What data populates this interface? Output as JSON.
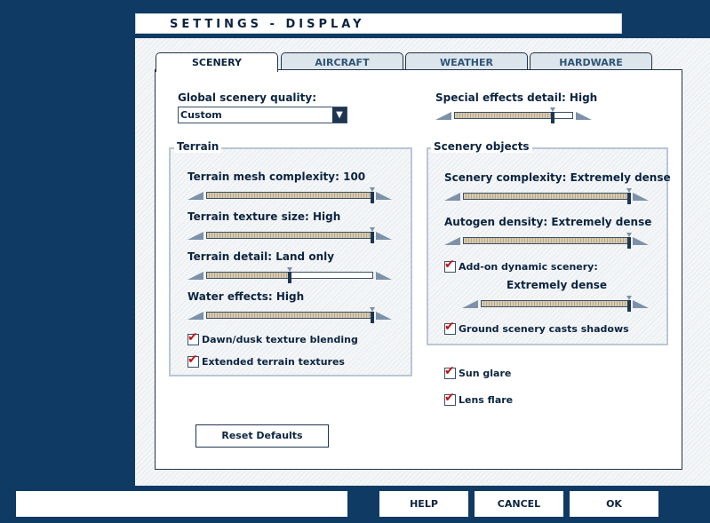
{
  "window": {
    "title": "SETTINGS - DISPLAY"
  },
  "tabs": [
    {
      "label": "SCENERY",
      "active": true
    },
    {
      "label": "AIRCRAFT",
      "active": false
    },
    {
      "label": "WEATHER",
      "active": false
    },
    {
      "label": "HARDWARE",
      "active": false
    }
  ],
  "global_quality": {
    "label": "Global scenery quality:",
    "value": "Custom"
  },
  "special_effects": {
    "label": "Special effects detail: High",
    "level": 0.83
  },
  "terrain": {
    "title": "Terrain",
    "sliders": [
      {
        "label": "Terrain mesh complexity: 100",
        "level": 1.0
      },
      {
        "label": "Terrain texture size: High",
        "level": 1.0
      },
      {
        "label": "Terrain detail: Land only",
        "level": 0.5
      },
      {
        "label": "Water effects: High",
        "level": 1.0
      }
    ],
    "checkboxes": [
      {
        "label": "Dawn/dusk texture blending",
        "checked": true
      },
      {
        "label": "Extended terrain textures",
        "checked": true
      }
    ]
  },
  "scenery_objects": {
    "title": "Scenery objects",
    "sliders": [
      {
        "label": "Scenery complexity: Extremely dense",
        "level": 1.0
      },
      {
        "label": "Autogen density: Extremely dense",
        "level": 1.0
      }
    ],
    "addon": {
      "label": "Add-on dynamic scenery:",
      "checked": true,
      "value_label": "Extremely dense",
      "level": 1.0
    },
    "shadows": {
      "label": "Ground scenery casts shadows",
      "checked": true
    }
  },
  "extras": [
    {
      "label": "Sun glare",
      "checked": true
    },
    {
      "label": "Lens flare",
      "checked": true
    }
  ],
  "buttons": {
    "reset": "Reset Defaults",
    "help": "HELP",
    "cancel": "CANCEL",
    "ok": "OK"
  },
  "icons": {
    "check": "✔",
    "dropdown_arrow": "▼"
  }
}
